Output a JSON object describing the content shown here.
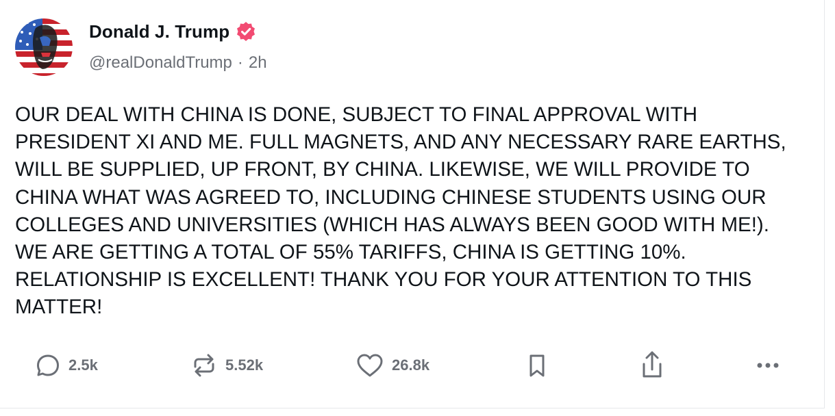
{
  "post": {
    "author": {
      "display_name": "Donald J. Trump",
      "handle": "@realDonaldTrump",
      "separator": "·",
      "time_ago": "2h",
      "verified_icon": "verified-badge-icon",
      "verified_color": "#f24b72"
    },
    "body": "OUR DEAL WITH CHINA IS DONE, SUBJECT TO FINAL APPROVAL WITH PRESIDENT XI AND ME. FULL MAGNETS, AND ANY NECESSARY RARE EARTHS, WILL BE SUPPLIED, UP FRONT, BY CHINA. LIKEWISE, WE WILL PROVIDE TO CHINA WHAT WAS AGREED TO, INCLUDING CHINESE STUDENTS USING OUR COLLEGES AND UNIVERSITIES (WHICH HAS ALWAYS BEEN GOOD WITH ME!). WE ARE GETTING A TOTAL OF 55% TARIFFS, CHINA IS GETTING 10%. RELATIONSHIP IS EXCELLENT! THANK YOU FOR YOUR ATTENTION TO THIS MATTER!",
    "actions": {
      "replies": {
        "icon": "reply-icon",
        "count": "2.5k"
      },
      "retruths": {
        "icon": "repost-icon",
        "count": "5.52k"
      },
      "likes": {
        "icon": "heart-icon",
        "count": "26.8k"
      },
      "bookmark": {
        "icon": "bookmark-icon"
      },
      "share": {
        "icon": "share-icon"
      },
      "more": {
        "icon": "more-icon"
      }
    }
  },
  "colors": {
    "text_primary": "#0f1419",
    "text_secondary": "#6b6f76",
    "border": "#e6e7ea"
  }
}
